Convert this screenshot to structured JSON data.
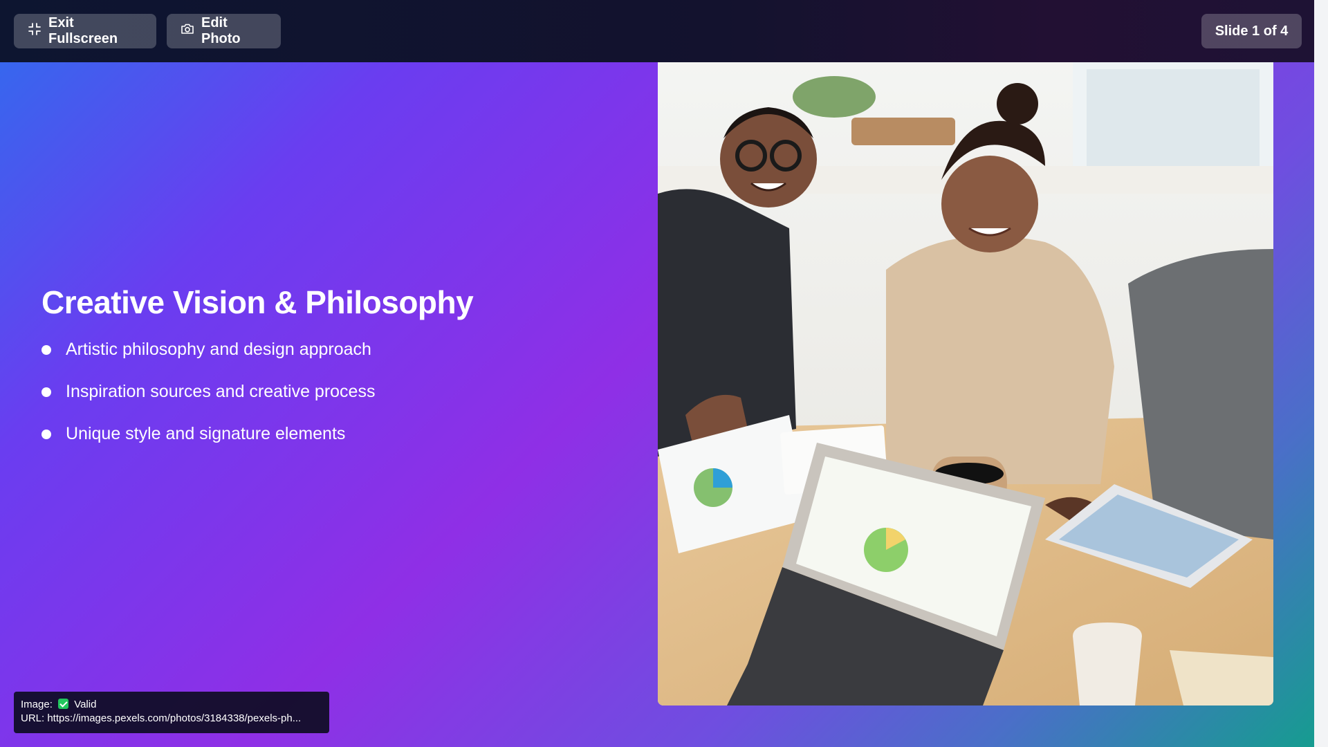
{
  "toolbar": {
    "exit_label": "Exit Fullscreen",
    "exit_icon": "minimize-icon",
    "edit_label": "Edit Photo",
    "edit_icon": "camera-icon",
    "slide_counter": "Slide 1 of 4"
  },
  "slide": {
    "title": "Creative Vision & Philosophy",
    "bullets": [
      "Artistic philosophy and design approach",
      "Inspiration sources and creative process",
      "Unique style and signature elements"
    ],
    "photo_alt": "photo-team-meeting",
    "gradient_colors": [
      "#2f6ded",
      "#8f2fe6",
      "#169c90"
    ]
  },
  "status": {
    "image_label": "Image:",
    "image_status": "Valid",
    "url_line": "URL: https://images.pexels.com/photos/3184338/pexels-ph..."
  }
}
